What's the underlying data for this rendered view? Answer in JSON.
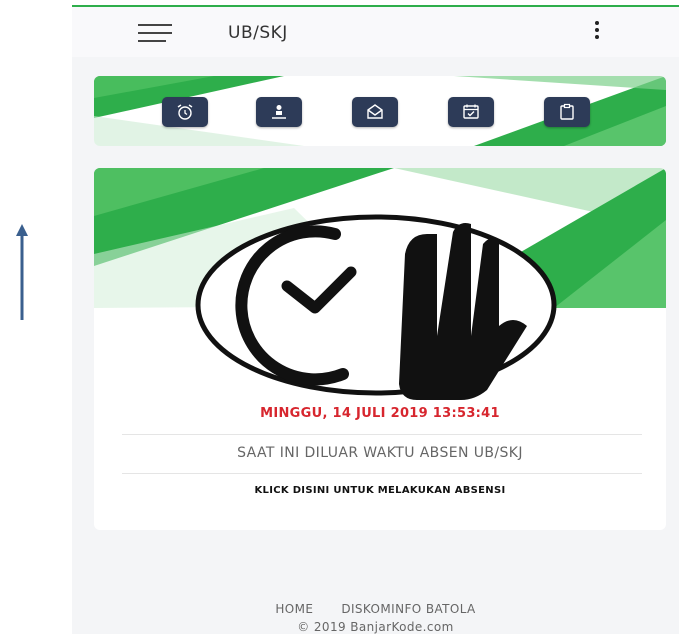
{
  "app": {
    "title": "UB/SKJ",
    "menu_icon": "hamburger-menu-icon",
    "overflow_icon": "more-vertical-icon"
  },
  "quick_menu": [
    {
      "name": "alarm-clock",
      "icon": "alarm-clock-icon"
    },
    {
      "name": "person-upload",
      "icon": "person-upload-icon"
    },
    {
      "name": "mail-open",
      "icon": "mail-open-icon"
    },
    {
      "name": "calendar-check",
      "icon": "calendar-check-icon"
    },
    {
      "name": "clipboard",
      "icon": "clipboard-icon"
    }
  ],
  "hero": {
    "icon": "clock-hand-attendance-icon",
    "date_time": "MINGGU, 14 JULI 2019 13:53:41",
    "status": "SAAT INI DILUAR WAKTU ABSEN UB/SKJ",
    "cta": "KLICK DISINI UNTUK MELAKUKAN ABSENSI"
  },
  "footer": {
    "links": [
      "HOME",
      "DISKOMINFO BATOLA"
    ],
    "copyright": "© 2019 BanjarKode.com"
  },
  "colors": {
    "accent_green": "#2eae4b",
    "button_navy": "#2d3b58",
    "date_red": "#d7262e"
  }
}
